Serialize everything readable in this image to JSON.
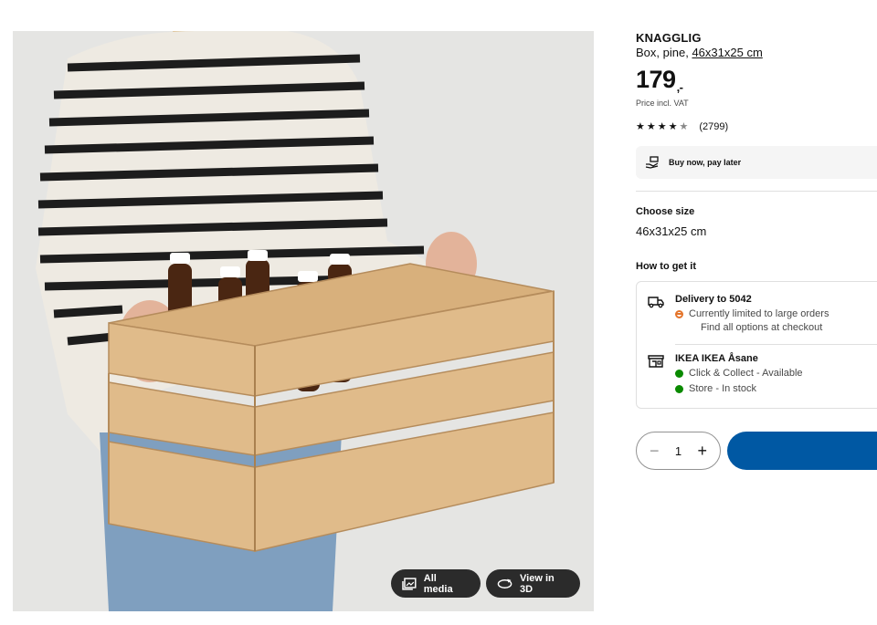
{
  "media": {
    "all_media_label": "All media",
    "view_3d_label": "View in 3D"
  },
  "product": {
    "name": "KNAGGLIG",
    "type_label": "Box, pine,",
    "dimensions": "46x31x25 cm",
    "price": "179",
    "price_suffix": ",-",
    "vat_note": "Price incl. VAT",
    "rating": {
      "stars": 4.5,
      "count": "(2799)"
    }
  },
  "bnpl": {
    "label": "Buy now, pay later",
    "icon": "payment-hand-icon"
  },
  "size": {
    "label": "Choose size",
    "value": "46x31x25 cm"
  },
  "fulfilment": {
    "label": "How to get it",
    "delivery": {
      "icon": "truck-icon",
      "title": "Delivery to 5042",
      "status": "Currently limited to large orders",
      "status_color": "#e4742a",
      "note": "Find all options at checkout"
    },
    "store": {
      "icon": "store-icon",
      "title": "IKEA IKEA Åsane",
      "click_collect": "Click & Collect - Available",
      "in_store": "Store - In stock",
      "status_color": "#0a8a00"
    }
  },
  "quantity": {
    "value": "1",
    "minus_icon": "minus-icon",
    "plus_icon": "plus-icon"
  },
  "colors": {
    "primary_button": "#0058a3",
    "panel": "#f5f5f5"
  }
}
